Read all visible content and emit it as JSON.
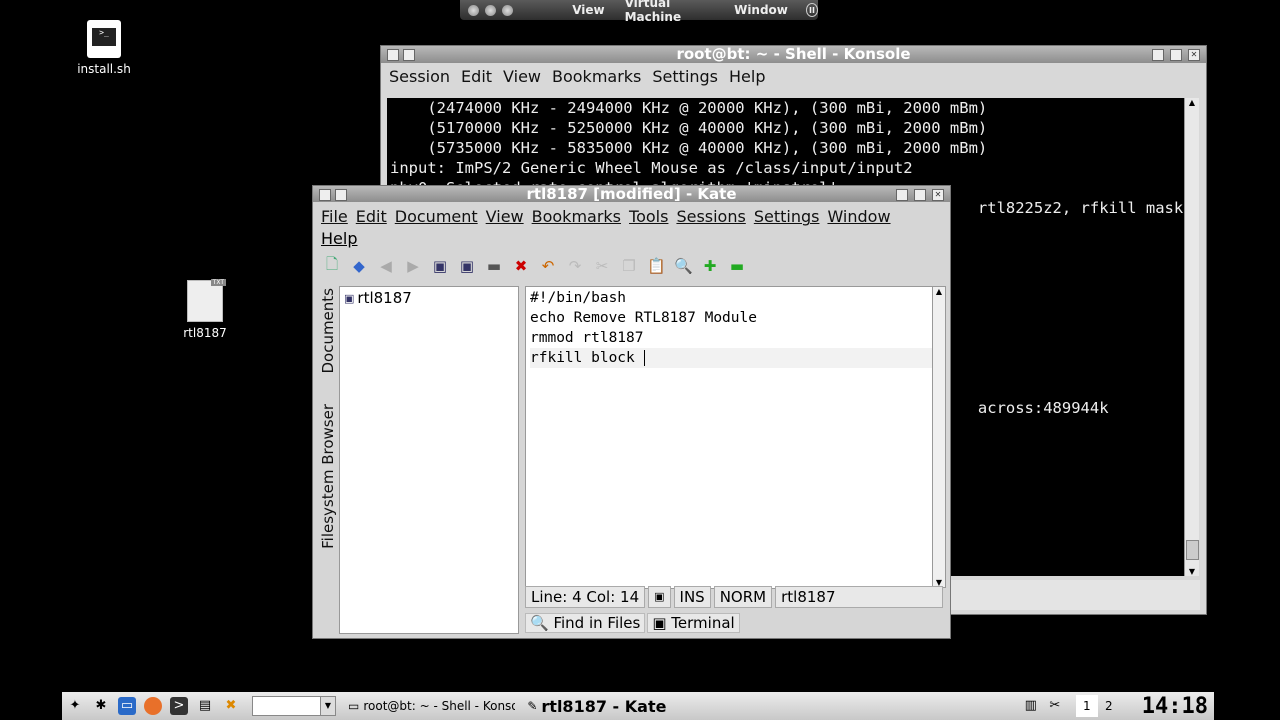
{
  "vm_bar": {
    "menus": [
      "View",
      "Virtual Machine",
      "Window"
    ]
  },
  "desktop": {
    "icons": [
      {
        "label": "install.sh"
      },
      {
        "label": "rtl8187"
      }
    ]
  },
  "konsole": {
    "title": "root@bt: ~ - Shell - Konsole",
    "menu": [
      "Session",
      "Edit",
      "View",
      "Bookmarks",
      "Settings",
      "Help"
    ],
    "lines": [
      "    (2474000 KHz - 2494000 KHz @ 20000 KHz), (300 mBi, 2000 mBm)",
      "    (5170000 KHz - 5250000 KHz @ 40000 KHz), (300 mBi, 2000 mBm)",
      "    (5735000 KHz - 5835000 KHz @ 40000 KHz), (300 mBi, 2000 mBm)",
      "input: ImPS/2 Generic Wheel Mouse as /class/input/input2",
      "phy0: Selected rate control algorithm 'minstrel'",
      "                                                               rtl8225z2, rfkill mask",
      "",
      "",
      "",
      "",
      "",
      "",
      "",
      "",
      "",
      "                                                               across:489944k"
    ]
  },
  "kate": {
    "title": "rtl8187 [modified] - Kate",
    "menu": [
      "File",
      "Edit",
      "Document",
      "View",
      "Bookmarks",
      "Tools",
      "Sessions",
      "Settings",
      "Window"
    ],
    "menu_help": "Help",
    "side_tabs": {
      "documents": "Documents",
      "filesystem": "Filesystem Browser"
    },
    "documents": [
      "rtl8187"
    ],
    "editor_lines": [
      "#!/bin/bash",
      "echo Remove RTL8187 Module",
      "rmmod rtl8187",
      "rfkill block "
    ],
    "status": {
      "position": "Line: 4 Col: 14",
      "ins": "INS",
      "mode": "NORM",
      "doc": "rtl8187"
    },
    "bottom_tabs": [
      "Find in Files",
      "Terminal"
    ]
  },
  "taskbar": {
    "tasks": [
      {
        "label": "root@bt: ~ - Shell - Konsole"
      },
      {
        "label": "rtl8187 - Kate"
      }
    ],
    "pager": [
      "1",
      "2"
    ],
    "clock": "14:18"
  }
}
